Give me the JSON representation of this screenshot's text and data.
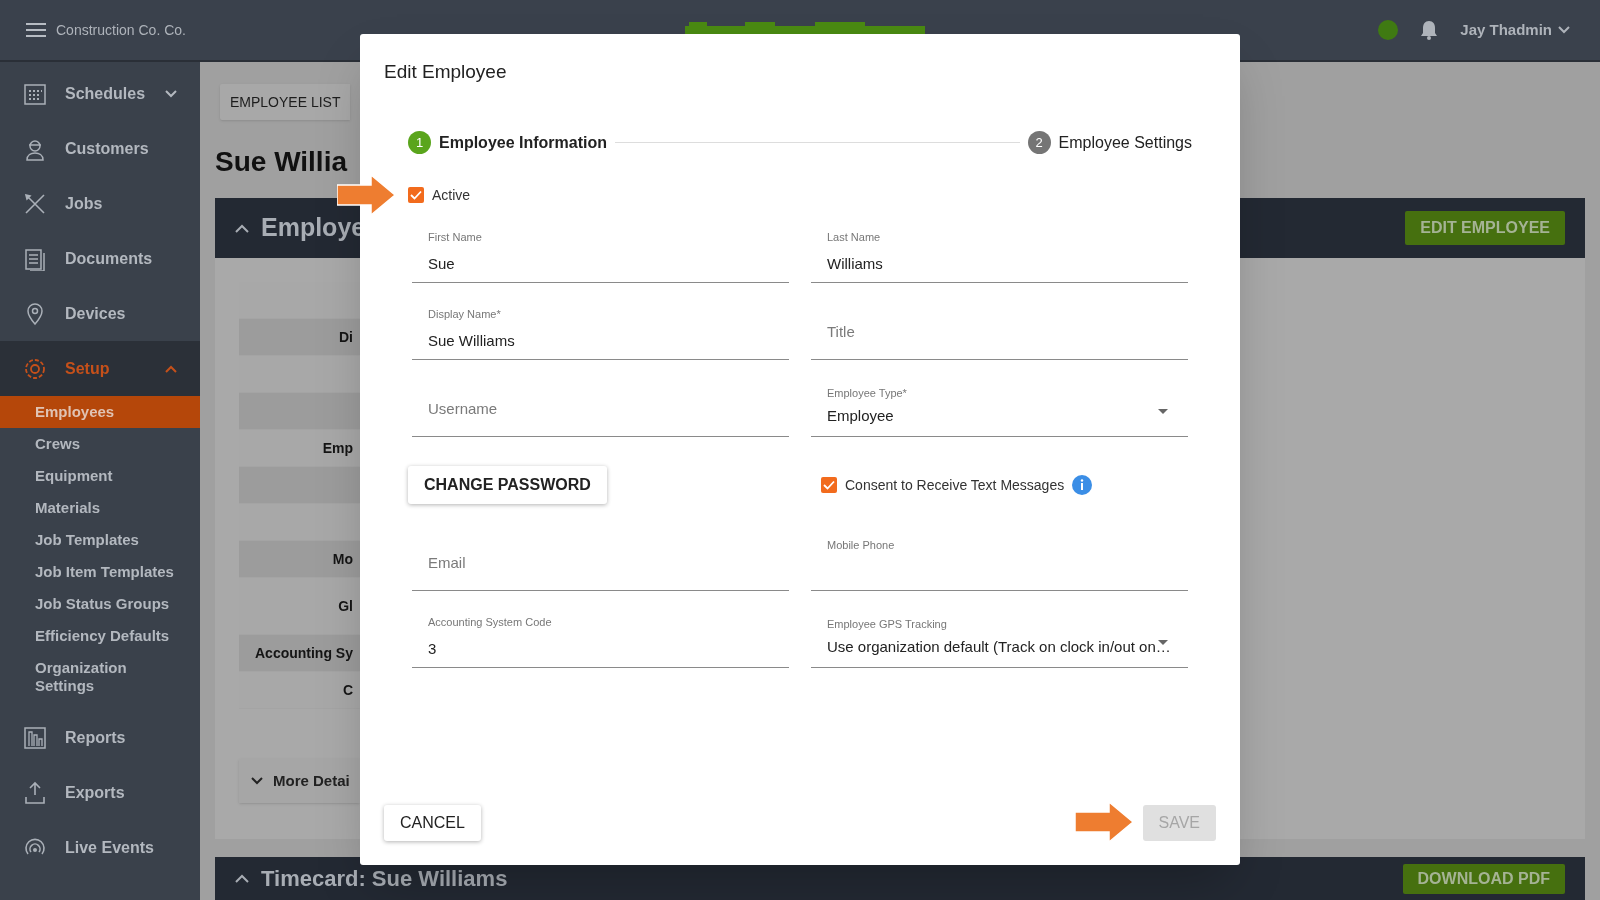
{
  "topbar": {
    "company": "Construction Co. Co.",
    "user": "Jay Thadmin"
  },
  "sidebar": {
    "items": [
      {
        "label": "Schedules",
        "kind": "group",
        "selected": false,
        "expanded": false
      },
      {
        "label": "Customers",
        "kind": "link",
        "selected": false
      },
      {
        "label": "Jobs",
        "kind": "link",
        "selected": false
      },
      {
        "label": "Documents",
        "kind": "link",
        "selected": false
      },
      {
        "label": "Devices",
        "kind": "link",
        "selected": false
      },
      {
        "label": "Setup",
        "kind": "group",
        "selected": true,
        "expanded": true,
        "children": [
          {
            "label": "Employees",
            "selected": true
          },
          {
            "label": "Crews",
            "selected": false
          },
          {
            "label": "Equipment",
            "selected": false
          },
          {
            "label": "Materials",
            "selected": false
          },
          {
            "label": "Job Templates",
            "selected": false
          },
          {
            "label": "Job Item Templates",
            "selected": false
          },
          {
            "label": "Job Status Groups",
            "selected": false
          },
          {
            "label": "Efficiency Defaults",
            "selected": false
          },
          {
            "label": "Organization Settings",
            "selected": false
          }
        ]
      },
      {
        "label": "Reports",
        "kind": "link",
        "selected": false
      },
      {
        "label": "Exports",
        "kind": "link",
        "selected": false
      },
      {
        "label": "Live Events",
        "kind": "link",
        "selected": false
      }
    ]
  },
  "page": {
    "back_button": "EMPLOYEE LIST",
    "title": "Sue Willia",
    "section": {
      "title": "Employe",
      "expanded": true,
      "action": "EDIT EMPLOYEE"
    },
    "detail_rows": [
      {
        "label": ""
      },
      {
        "label": "Di"
      },
      {
        "label": ""
      },
      {
        "label": ""
      },
      {
        "label": "Emp"
      },
      {
        "label": ""
      },
      {
        "label": ""
      },
      {
        "label": "Mo"
      },
      {
        "label": "Gl",
        "tall": true
      },
      {
        "label": "Accounting Sy"
      },
      {
        "label": "C"
      }
    ],
    "more_details": "More Detai",
    "timecard": {
      "title": "Timecard: Sue Williams",
      "action": "DOWNLOAD PDF"
    }
  },
  "dialog": {
    "title": "Edit Employee",
    "steps": [
      {
        "number": "1",
        "label": "Employee Information",
        "selected": true
      },
      {
        "number": "2",
        "label": "Employee Settings",
        "selected": false
      }
    ],
    "active": {
      "label": "Active",
      "checked": true
    },
    "fields": [
      {
        "kind": "text",
        "label": "First Name",
        "value": "Sue"
      },
      {
        "kind": "text",
        "label": "Last Name",
        "value": "Williams"
      },
      {
        "kind": "text",
        "label": "Display Name*",
        "value": "Sue Williams"
      },
      {
        "kind": "text",
        "placeholder": "Title"
      },
      {
        "kind": "text",
        "placeholder": "Username"
      },
      {
        "kind": "select",
        "label": "Employee Type*",
        "value": "Employee"
      },
      {
        "kind": "button",
        "label": "CHANGE PASSWORD"
      },
      {
        "kind": "checkbox",
        "label": "Consent to Receive Text Messages",
        "checked": true,
        "info": true
      },
      {
        "kind": "text",
        "placeholder": "Email"
      },
      {
        "kind": "text",
        "label": "Mobile Phone"
      },
      {
        "kind": "text",
        "label": "Accounting System Code",
        "value": "3"
      },
      {
        "kind": "select",
        "label": "Employee GPS Tracking",
        "value": "Use organization default (Track on clock in/out on…"
      }
    ],
    "cancel": "CANCEL",
    "save": {
      "label": "SAVE",
      "disabled": true
    }
  }
}
